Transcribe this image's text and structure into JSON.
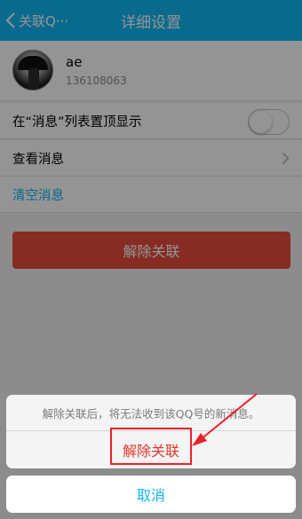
{
  "header": {
    "back_label": "关联Q···",
    "title": "详细设置"
  },
  "profile": {
    "name": "ae",
    "qq_number": "136108063"
  },
  "settings": {
    "pin_top_label": "在“消息”列表置顶显示",
    "pin_top_on": false,
    "view_messages_label": "查看消息",
    "clear_messages_label": "清空消息"
  },
  "unlink_button_label": "解除关联",
  "action_sheet": {
    "message": "解除关联后，将无法收到该QQ号的新消息。",
    "confirm_label": "解除关联",
    "cancel_label": "取消"
  },
  "colors": {
    "header": "#12b7f5",
    "danger": "#e74c3c",
    "link": "#12b7f5",
    "annotation": "#e8212a"
  },
  "icons": {
    "back": "chevron-left-icon",
    "row_arrow": "chevron-right-icon",
    "annotation_arrow": "arrow-pointer-icon"
  }
}
